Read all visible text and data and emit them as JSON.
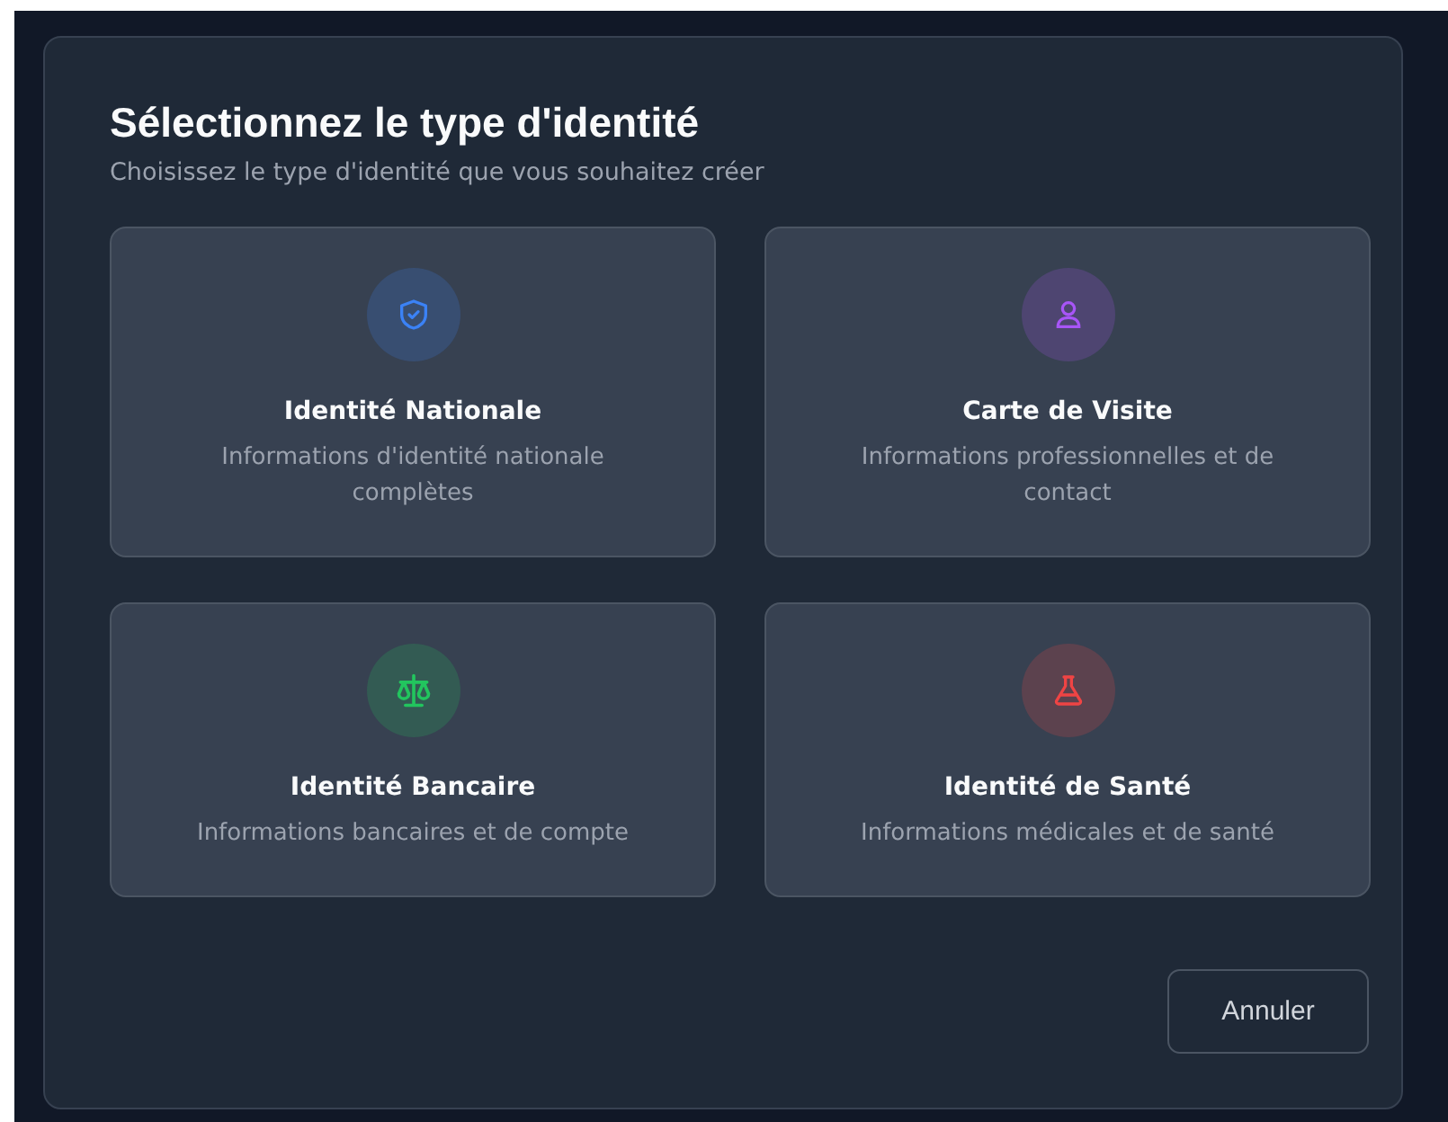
{
  "dialog": {
    "title": "Sélectionnez le type d'identité",
    "subtitle": "Choisissez le type d'identité que vous souhaitez créer",
    "options": [
      {
        "kind": "shield",
        "color": "#3b82f6",
        "title": "Identité Nationale",
        "description": "Informations d'identité nationale complètes"
      },
      {
        "kind": "person",
        "color": "#a855f7",
        "title": "Carte de Visite",
        "description": "Informations professionnelles et de contact"
      },
      {
        "kind": "scale",
        "color": "#22c55e",
        "title": "Identité Bancaire",
        "description": "Informations bancaires et de compte"
      },
      {
        "kind": "flask",
        "color": "#ef4444",
        "title": "Identité de Santé",
        "description": "Informations médicales et de santé"
      }
    ],
    "cancel_button": "Annuler"
  }
}
